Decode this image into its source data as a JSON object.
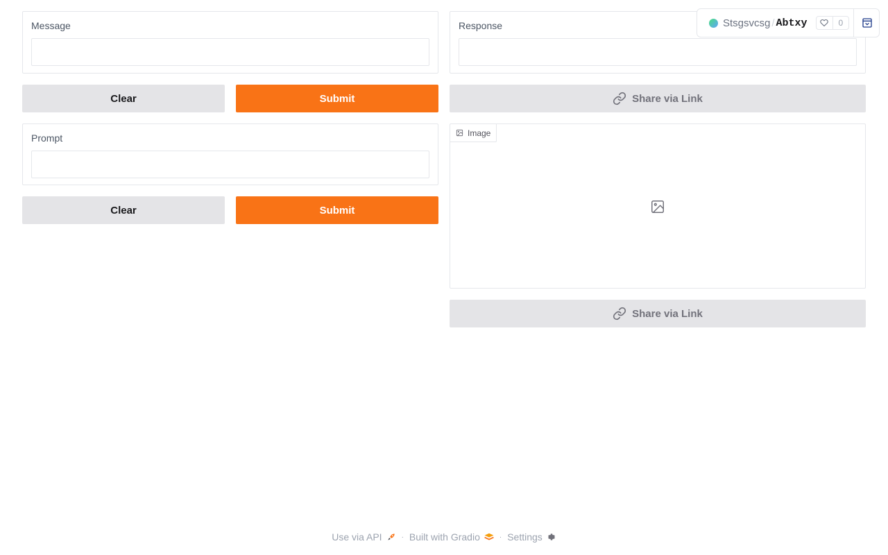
{
  "message": {
    "label": "Message",
    "value": "",
    "placeholder": ""
  },
  "response": {
    "label": "Response",
    "value": "",
    "placeholder": ""
  },
  "prompt": {
    "label": "Prompt",
    "value": "",
    "placeholder": ""
  },
  "buttons": {
    "clear_1": "Clear",
    "submit_1": "Submit",
    "clear_2": "Clear",
    "submit_2": "Submit",
    "share_1": "Share via Link",
    "share_2": "Share via Link"
  },
  "image": {
    "label": "Image"
  },
  "space": {
    "owner": "Stsgsvcsg",
    "separator": "/",
    "name": "Abtxy",
    "likes": "0"
  },
  "footer": {
    "api": "Use via API",
    "built": "Built with Gradio",
    "settings": "Settings",
    "separator": "·"
  },
  "colors": {
    "primary": "#f97316",
    "secondary": "#e4e4e7"
  },
  "icons": [
    "link-icon",
    "image-icon",
    "heart-icon",
    "collapse-icon",
    "rocket-icon",
    "gradio-logo-icon",
    "gear-icon"
  ]
}
